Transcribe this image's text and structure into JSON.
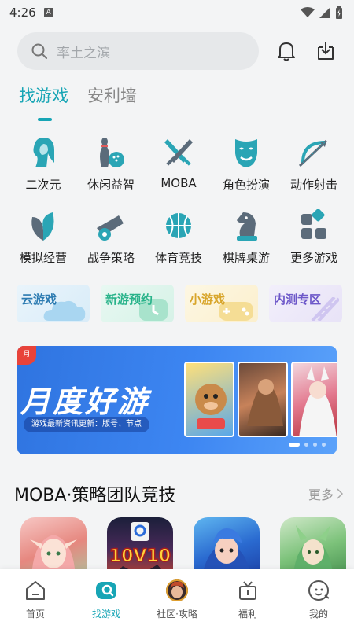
{
  "status": {
    "time": "4:26"
  },
  "search": {
    "placeholder": "率土之滨"
  },
  "tabs": [
    {
      "label": "找游戏",
      "active": true
    },
    {
      "label": "安利墙",
      "active": false
    }
  ],
  "categories": [
    {
      "label": "二次元",
      "icon": "anime-girl-icon"
    },
    {
      "label": "休闲益智",
      "icon": "bowling-icon"
    },
    {
      "label": "MOBA",
      "icon": "crossed-swords-icon"
    },
    {
      "label": "角色扮演",
      "icon": "mask-icon"
    },
    {
      "label": "动作射击",
      "icon": "bow-arrow-icon"
    },
    {
      "label": "模拟经营",
      "icon": "leaf-icon"
    },
    {
      "label": "战争策略",
      "icon": "cannon-icon"
    },
    {
      "label": "体育竞技",
      "icon": "basketball-icon"
    },
    {
      "label": "棋牌桌游",
      "icon": "chess-knight-icon"
    },
    {
      "label": "更多游戏",
      "icon": "grid-icon"
    }
  ],
  "quick_links": [
    {
      "label": "云游戏"
    },
    {
      "label": "新游预约"
    },
    {
      "label": "小游戏"
    },
    {
      "label": "内测专区"
    }
  ],
  "banner": {
    "title": "月度好游",
    "subtitle": "游戏最新资讯更新：版号、节点",
    "corner": "月",
    "active_slide": 1,
    "slide_count": 4
  },
  "section": {
    "title": "MOBA·策略团队竞技",
    "more": "更多"
  },
  "games": [
    {
      "name": "elf-game-thumbnail",
      "badge": ""
    },
    {
      "name": "10v10-game-thumbnail",
      "badge": "10V10"
    },
    {
      "name": "hero-game-thumbnail",
      "badge": ""
    },
    {
      "name": "dryad-game-thumbnail",
      "badge": ""
    }
  ],
  "bottom_nav": [
    {
      "label": "首页",
      "icon": "home-icon",
      "active": false
    },
    {
      "label": "找游戏",
      "icon": "gamepad-search-icon",
      "active": true
    },
    {
      "label": "社区·攻略",
      "icon": "avatar-icon",
      "active": false
    },
    {
      "label": "福利",
      "icon": "gift-icon",
      "active": false
    },
    {
      "label": "我的",
      "icon": "profile-icon",
      "active": false
    }
  ],
  "colors": {
    "accent": "#17a5b5",
    "banner_blue": "#3d86f2"
  }
}
